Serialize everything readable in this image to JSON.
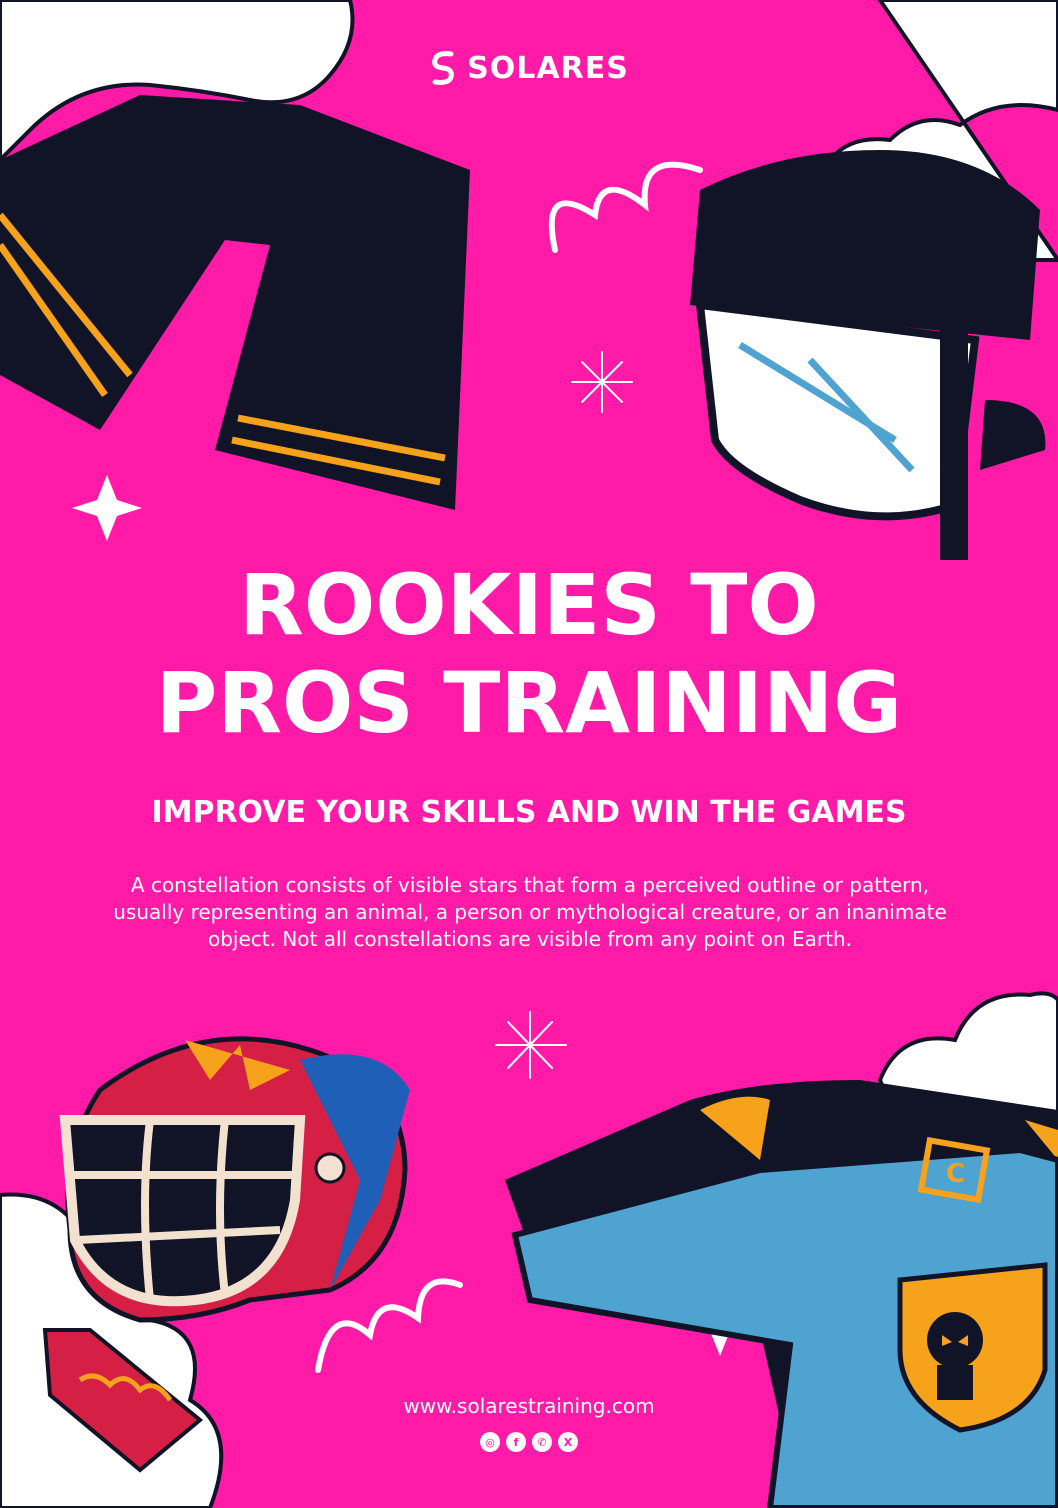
{
  "brand": {
    "name": "SOLARES"
  },
  "headline": {
    "line1": "ROOKIES TO",
    "line2": "PROS TRAINING"
  },
  "subheadline": "IMPROVE YOUR SKILLS AND WIN THE GAMES",
  "body": "A constellation consists of visible stars that form a perceived outline or pattern, usually representing an animal, a person or mythological creature, or an inanimate object. Not all constellations are visible from any point on Earth.",
  "footer": {
    "website": "www.solarestraining.com",
    "socials": [
      {
        "icon": "instagram-icon",
        "glyph": "◎"
      },
      {
        "icon": "facebook-icon",
        "glyph": "f"
      },
      {
        "icon": "whatsapp-icon",
        "glyph": "✆"
      },
      {
        "icon": "x-icon",
        "glyph": "X"
      }
    ]
  },
  "colors": {
    "background": "#ff1aa8",
    "navy": "#111427",
    "accent_orange": "#f7a21b",
    "jersey_blue": "#4fa3d1",
    "helmet_red": "#d61f45",
    "white": "#ffffff"
  },
  "illustrations": [
    "hockey-pants-illustration",
    "hockey-helmet-illustration",
    "goalie-mask-illustration",
    "hockey-jersey-illustration",
    "cloud-decoration",
    "sparkle-star-decoration",
    "squiggle-decoration"
  ]
}
